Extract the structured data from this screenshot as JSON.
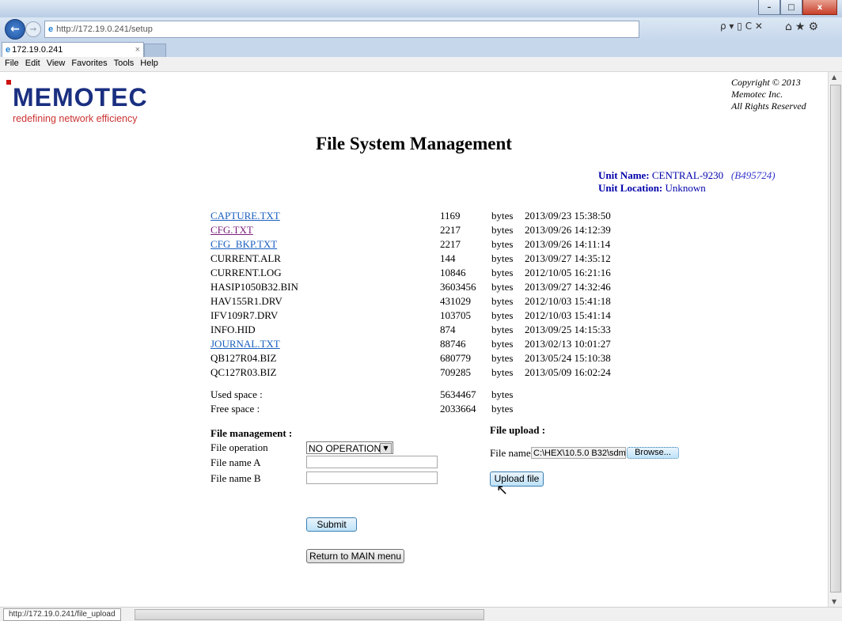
{
  "browser": {
    "address": "http://172.19.0.241/setup",
    "tab_title": "172.19.0.241",
    "tab_close": "×",
    "search_tools": "ρ ▾ ▯ C ✕",
    "win_min": "–",
    "win_max": "□",
    "win_close": "x",
    "status_url": "http://172.19.0.241/file_upload"
  },
  "menu": [
    "File",
    "Edit",
    "View",
    "Favorites",
    "Tools",
    "Help"
  ],
  "logo": {
    "word": "MEMOTEC",
    "tagline": "redefining network efficiency"
  },
  "copyright": [
    "Copyright © 2013",
    "Memotec Inc.",
    "All Rights Reserved"
  ],
  "page_title": "File System Management",
  "unit": {
    "name_label": "Unit Name:",
    "name": "CENTRAL-9230",
    "serial": "(B495724)",
    "location_label": "Unit Location:",
    "location": "Unknown"
  },
  "files": [
    {
      "name": "CAPTURE.TXT",
      "size": "1169",
      "unit": "bytes",
      "date": "2013/09/23 15:38:50",
      "kind": "link"
    },
    {
      "name": "CFG.TXT",
      "size": "2217",
      "unit": "bytes",
      "date": "2013/09/26 14:12:39",
      "kind": "visited"
    },
    {
      "name": "CFG_BKP.TXT",
      "size": "2217",
      "unit": "bytes",
      "date": "2013/09/26 14:11:14",
      "kind": "link"
    },
    {
      "name": "CURRENT.ALR",
      "size": "144",
      "unit": "bytes",
      "date": "2013/09/27 14:35:12",
      "kind": "plain"
    },
    {
      "name": "CURRENT.LOG",
      "size": "10846",
      "unit": "bytes",
      "date": "2012/10/05 16:21:16",
      "kind": "plain"
    },
    {
      "name": "HASIP1050B32.BIN",
      "size": "3603456",
      "unit": "bytes",
      "date": "2013/09/27 14:32:46",
      "kind": "plain"
    },
    {
      "name": "HAV155R1.DRV",
      "size": "431029",
      "unit": "bytes",
      "date": "2012/10/03 15:41:18",
      "kind": "plain"
    },
    {
      "name": "IFV109R7.DRV",
      "size": "103705",
      "unit": "bytes",
      "date": "2012/10/03 15:41:14",
      "kind": "plain"
    },
    {
      "name": "INFO.HID",
      "size": "874",
      "unit": "bytes",
      "date": "2013/09/25 14:15:33",
      "kind": "plain"
    },
    {
      "name": "JOURNAL.TXT",
      "size": "88746",
      "unit": "bytes",
      "date": "2013/02/13 10:01:27",
      "kind": "link"
    },
    {
      "name": "QB127R04.BIZ",
      "size": "680779",
      "unit": "bytes",
      "date": "2013/05/24 15:10:38",
      "kind": "plain"
    },
    {
      "name": "QC127R03.BIZ",
      "size": "709285",
      "unit": "bytes",
      "date": "2013/05/09 16:02:24",
      "kind": "plain"
    }
  ],
  "space": {
    "used_label": "Used space :",
    "used": "5634467",
    "free_label": "Free space :",
    "free": "2033664",
    "unit": "bytes"
  },
  "management": {
    "heading": "File management :",
    "operation_label": "File operation",
    "operation_value": "NO OPERATION",
    "name_a_label": "File name A",
    "name_b_label": "File name B",
    "submit": "Submit",
    "return": "Return to MAIN menu"
  },
  "upload": {
    "heading": "File upload :",
    "file_label": "File name",
    "file_value": "C:\\HEX\\10.5.0 B32\\sdm",
    "browse": "Browse...",
    "upload": "Upload file"
  }
}
